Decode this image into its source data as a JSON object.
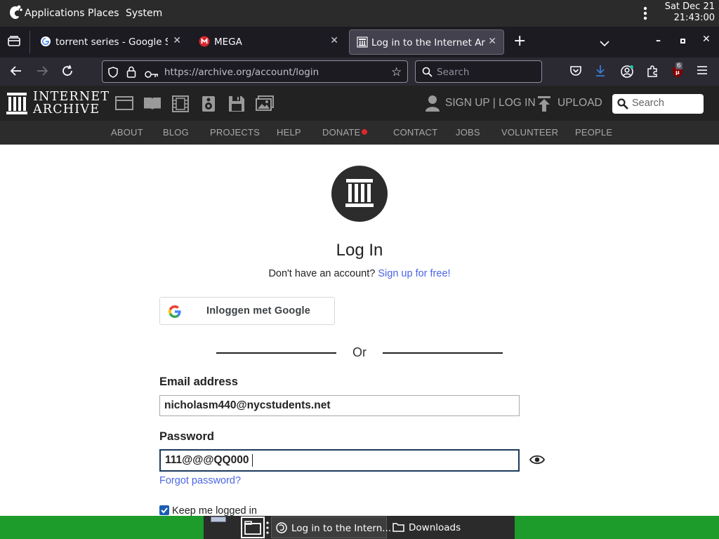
{
  "gnome": {
    "menus": [
      "Applications",
      "Places",
      "System"
    ],
    "date": "Sat Dec 21",
    "time": "21:43:00"
  },
  "tabs": [
    {
      "title": "torrent series - Google Sear",
      "icon": "google-favicon"
    },
    {
      "title": "MEGA",
      "icon": "mega-favicon"
    },
    {
      "title": "Log in to the Internet Archiv",
      "icon": "archive-favicon",
      "active": true
    }
  ],
  "toolbar": {
    "url": "https://archive.org/account/login",
    "search_placeholder": "Search",
    "extension_badge": "6"
  },
  "ia": {
    "logo_line1": "INTERNET",
    "logo_line2": "ARCHIVE",
    "auth": "SIGN UP | LOG IN",
    "upload": "UPLOAD",
    "search_placeholder": "Search",
    "nav": [
      "ABOUT",
      "BLOG",
      "PROJECTS",
      "HELP",
      "DONATE",
      "CONTACT",
      "JOBS",
      "VOLUNTEER",
      "PEOPLE"
    ]
  },
  "login": {
    "title": "Log In",
    "no_account": "Don't have an account?",
    "signup_link": "Sign up for free!",
    "google_button": "Inloggen met Google",
    "or": "Or",
    "email_label": "Email address",
    "email_value": "nicholasm440@nycstudents.net",
    "password_label": "Password",
    "password_value": "111@@@QQ000",
    "forgot": "Forgot password?",
    "keep_logged_in": "Keep me logged in",
    "keep_checked": true
  },
  "taskbar": {
    "tasks": [
      "Log in to the Intern...",
      "Downloads"
    ]
  },
  "colors": {
    "taskbar": "#1d9b2b",
    "link": "#4b64e6",
    "donate_dot": "#e0262a"
  }
}
